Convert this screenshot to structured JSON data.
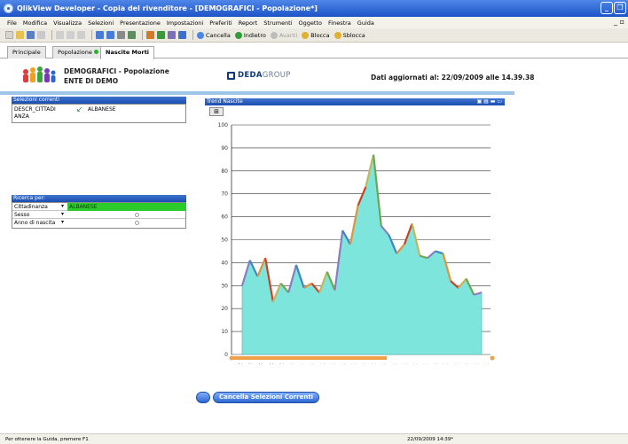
{
  "window": {
    "title": "QlikView Developer - Copia del rivenditore - [DEMOGRAFICI - Popolazione*]",
    "minimize": "_",
    "restore": "❐",
    "doc_controls": "_ ▫"
  },
  "menu": [
    "File",
    "Modifica",
    "Visualizza",
    "Selezioni",
    "Presentazione",
    "Impostazioni",
    "Preferiti",
    "Report",
    "Strumenti",
    "Oggetto",
    "Finestra",
    "Guida"
  ],
  "toolbar": {
    "cancella": "Cancella",
    "indietro": "Indietro",
    "avanti": "Avanti",
    "blocca": "Blocca",
    "sblocca": "Sblocca"
  },
  "tabs": [
    "Principale",
    "Popolazione",
    "Nascite Morti"
  ],
  "header": {
    "title": "DEMOGRAFICI - Popolazione",
    "subtitle": "ENTE DI DEMO",
    "brand_strong": "DEDA",
    "brand_light": "GROUP",
    "updated": "Dati aggiornati al: 22/09/2009 alle 14.39.38"
  },
  "current_selections": {
    "title": "Selezioni correnti",
    "field": "DESCR_CITTADINANZA",
    "field_line1": "DESCR_CITTADI",
    "field_line2": "ANZA",
    "value": "ALBANESE"
  },
  "search": {
    "title": "Ricerca per:",
    "rows": [
      {
        "label": "Cittadinanza",
        "value": "ALBANESE"
      },
      {
        "label": "Sesso",
        "value": ""
      },
      {
        "label": "Anno di nascita",
        "value": ""
      }
    ]
  },
  "chart_data": {
    "type": "area",
    "title": "Trend Nascite",
    "ylim": [
      0,
      100
    ],
    "yticks": [
      0,
      10,
      20,
      30,
      40,
      50,
      60,
      70,
      80,
      90,
      100
    ],
    "xlabels": [
      "2009",
      "2007",
      "2005",
      "2003",
      "2001",
      "1999",
      "1997",
      "1995",
      "1993",
      "1991",
      "1989",
      "1987",
      "1985",
      "1983",
      "1981",
      "1979",
      "1977",
      "1975",
      "1973",
      "1971",
      "1969",
      "1967",
      "1965",
      "1963",
      "1961"
    ],
    "values": [
      30,
      41,
      34,
      42,
      23,
      31,
      27,
      39,
      29,
      31,
      27,
      36,
      28,
      54,
      48,
      65,
      73,
      87,
      56,
      52,
      44,
      48,
      57,
      43,
      42,
      45,
      44,
      32,
      29,
      33,
      26,
      27
    ]
  },
  "buttons": {
    "clear": "Cancella Selezioni Correnti"
  },
  "status": {
    "left": "Per ottenere la Guida, premere F1",
    "right": "22/09/2009 14:39*"
  },
  "colors": {
    "accent": "#1c54c7",
    "area_fill": "#7ee5dc",
    "selected": "#2ccb2c"
  }
}
